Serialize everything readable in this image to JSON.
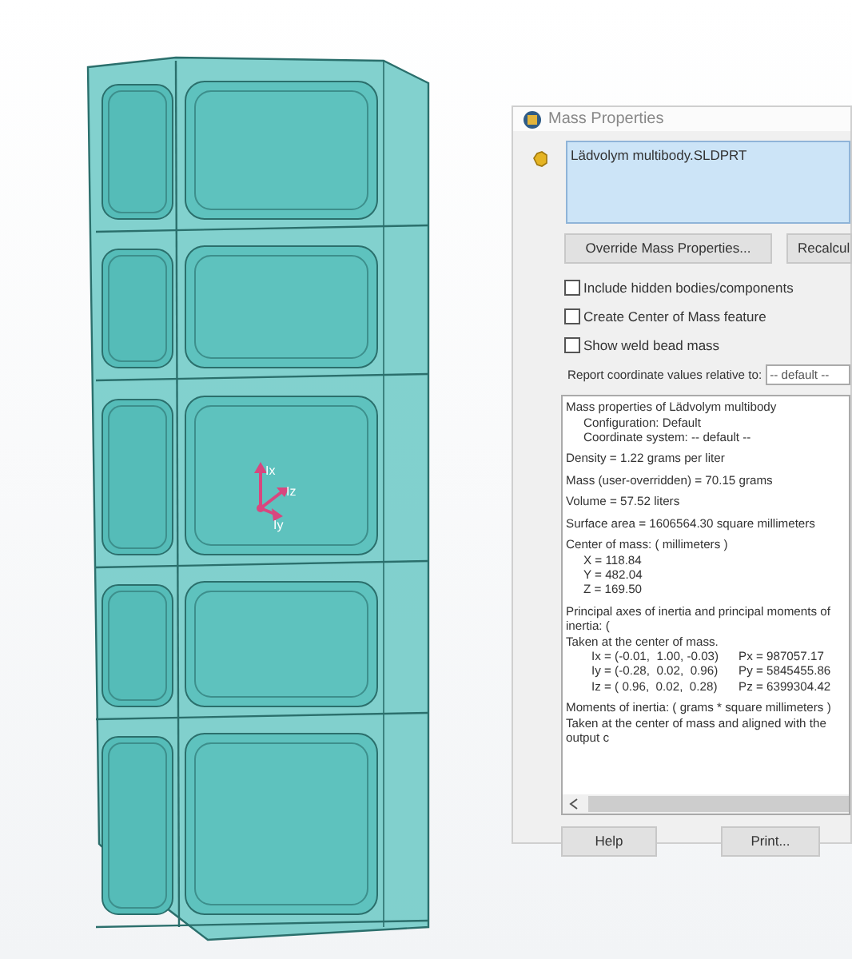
{
  "viewport": {
    "triad_labels": [
      "Ix",
      "Iz",
      "Iy"
    ]
  },
  "dialog": {
    "title": "Mass Properties",
    "file_list": [
      "Lädvolym multibody.SLDPRT"
    ],
    "buttons_top": [
      "Override Mass Properties...",
      "Recalcul"
    ],
    "options": [
      {
        "label": "Include hidden bodies/components",
        "checked": false
      },
      {
        "label": "Create Center of Mass feature",
        "checked": false
      },
      {
        "label": "Show weld bead mass",
        "checked": false
      }
    ],
    "report_label": "Report coordinate values relative to:",
    "report_select": "-- default --",
    "results": [
      [
        {
          "kind": "line",
          "text": "Mass properties of Lädvolym multibody"
        },
        {
          "kind": "indented",
          "text": "Configuration: Default"
        },
        {
          "kind": "indented",
          "text": "Coordinate system: -- default --"
        }
      ],
      [
        {
          "kind": "line",
          "text": "Density = 1.22 grams per liter"
        }
      ],
      [
        {
          "kind": "line",
          "text": "Mass (user-overridden) = 70.15 grams"
        }
      ],
      [
        {
          "kind": "line",
          "text": "Volume = 57.52 liters"
        }
      ],
      [
        {
          "kind": "line",
          "text": "Surface area = 1606564.30  square millimeters"
        }
      ],
      [
        {
          "kind": "line",
          "text": "Center of mass: ( millimeters )"
        },
        {
          "kind": "indented",
          "text": "X = 118.84"
        },
        {
          "kind": "indented",
          "text": "Y = 482.04"
        },
        {
          "kind": "indented",
          "text": "Z = 169.50"
        }
      ],
      [
        {
          "kind": "line",
          "text": "Principal axes of inertia and principal moments of inertia: ("
        },
        {
          "kind": "line",
          "text": "Taken at the center of mass."
        },
        {
          "kind": "pair",
          "text": "Ix = (-0.01,  1.00, -0.03)",
          "value": "Px = 987057.17"
        },
        {
          "kind": "pair",
          "text": "Iy = (-0.28,  0.02,  0.96)",
          "value": "Py = 5845455.86"
        },
        {
          "kind": "pair",
          "text": "Iz = ( 0.96,  0.02,  0.28)",
          "value": "Pz = 6399304.42"
        }
      ],
      [
        {
          "kind": "line",
          "text": "Moments of inertia: ( grams *  square millimeters )"
        },
        {
          "kind": "line",
          "text": "Taken at the center of mass and aligned with the output c"
        }
      ]
    ],
    "buttons_bottom": [
      "Help",
      "Print..."
    ]
  }
}
